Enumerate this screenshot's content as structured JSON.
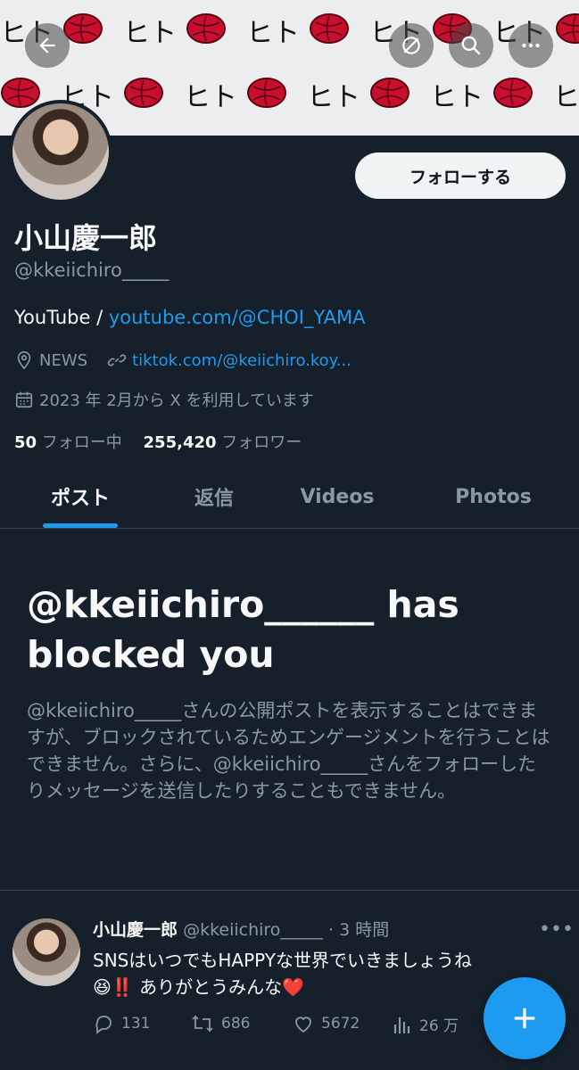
{
  "banner": {
    "pattern": [
      "flower",
      "sig"
    ],
    "signature_text": "ヒト"
  },
  "header": {
    "icons": [
      "back-arrow-icon",
      "grok-icon",
      "search-icon",
      "more-icon"
    ]
  },
  "profile": {
    "follow_label": "フォローする",
    "name": "小山慶一郎",
    "handle": "@kkeiichiro_____",
    "bio_prefix": "YouTube / ",
    "bio_link": "youtube.com/@CHOI_YAMA",
    "location": "NEWS",
    "website": "tiktok.com/@keiichiro.koy...",
    "joined": "2023 年 2月から X を利用しています",
    "following_count": "50",
    "following_label": "フォロー中",
    "followers_count": "255,420",
    "followers_label": "フォロワー"
  },
  "tabs": [
    {
      "label": "ポスト"
    },
    {
      "label": "返信"
    },
    {
      "label": "Videos"
    },
    {
      "label": "Photos"
    }
  ],
  "blocked": {
    "title": "@kkeiichiro______ has blocked you",
    "description": "@kkeiichiro_____さんの公開ポストを表示することはできますが、ブロックされているためエンゲージメントを行うことはできません。さらに、@kkeiichiro_____さんをフォローしたりメッセージを送信したりすることもできません。"
  },
  "post": {
    "author": "小山慶一郎",
    "handle": "@kkeiichiro_____",
    "time": "· 3 時間",
    "line1": "SNSはいつでもHAPPYな世界でいきましょうね",
    "emoji": "😆‼️",
    "line2_text": "ありがとうみんな",
    "heart": "❤️",
    "replies": "131",
    "reposts": "686",
    "likes": "5672",
    "views": "26 万"
  },
  "colors": {
    "accent": "#1d9bf0",
    "background": "#15202b",
    "muted": "#8b98a5"
  }
}
